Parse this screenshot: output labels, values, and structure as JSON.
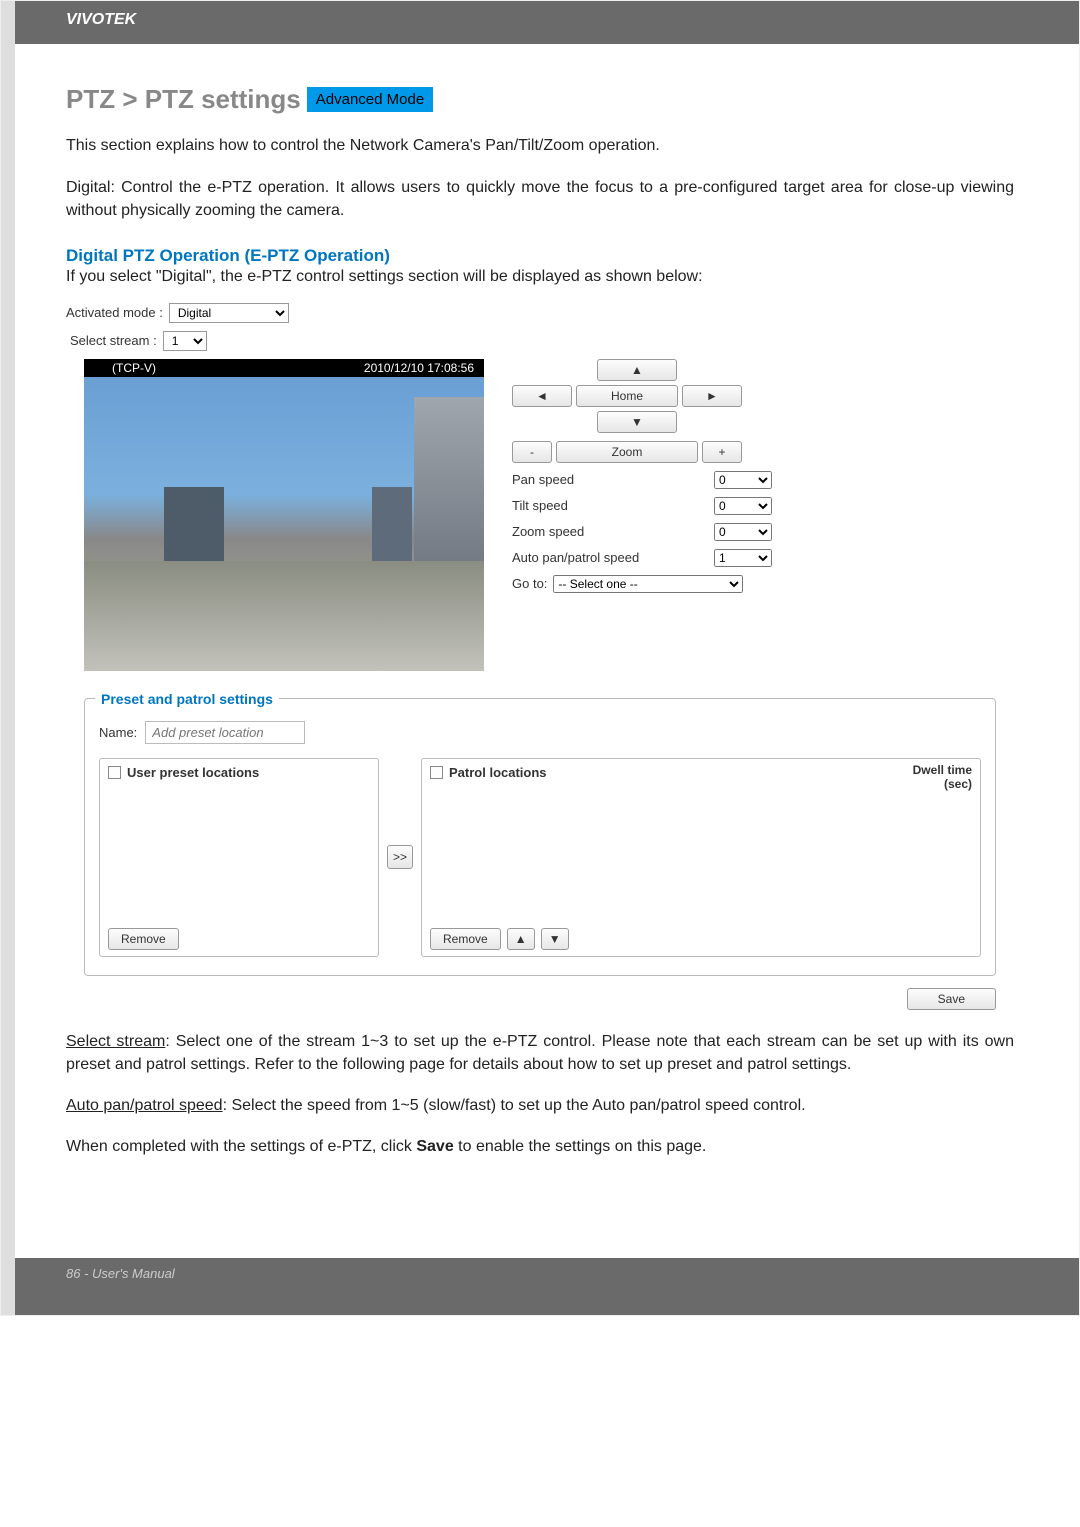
{
  "header": {
    "brand": "VIVOTEK"
  },
  "footer": {
    "text": "86 - User's Manual"
  },
  "title": {
    "breadcrumb": "PTZ > PTZ settings",
    "badge": "Advanced Mode"
  },
  "intro": {
    "p1": "This section explains how to control the Network Camera's Pan/Tilt/Zoom operation.",
    "p2": "Digital: Control the e-PTZ operation. It allows users to quickly move the focus to a pre-configured target area for close-up viewing without physically zooming the camera."
  },
  "section": {
    "heading": "Digital PTZ Operation (E-PTZ Operation)",
    "text": "If you select \"Digital\", the e-PTZ control settings section will be displayed as shown below:"
  },
  "ui": {
    "activated_mode_label": "Activated mode :",
    "activated_mode_value": "Digital",
    "select_stream_label": "Select stream :",
    "select_stream_value": "1",
    "video_header_left": "(TCP-V)",
    "video_header_right": "2010/12/10  17:08:56",
    "buttons": {
      "up": "▲",
      "down": "▼",
      "left": "◄",
      "right": "►",
      "home": "Home",
      "zoom_label": "Zoom",
      "minus": "-",
      "plus": "+"
    },
    "speeds": [
      {
        "label": "Pan speed",
        "value": "0"
      },
      {
        "label": "Tilt speed",
        "value": "0"
      },
      {
        "label": "Zoom speed",
        "value": "0"
      },
      {
        "label": "Auto pan/patrol speed",
        "value": "1"
      }
    ],
    "goto_label": "Go to:",
    "goto_value": "-- Select one --"
  },
  "preset": {
    "legend": "Preset and patrol settings",
    "name_label": "Name:",
    "name_placeholder": "Add preset location",
    "user_preset_title": "User preset locations",
    "patrol_title": "Patrol locations",
    "dwell_label_1": "Dwell time",
    "dwell_label_2": "(sec)",
    "move_btn": ">>",
    "remove": "Remove",
    "up": "▲",
    "down": "▼",
    "save": "Save"
  },
  "notes": {
    "select_stream_u": "Select stream",
    "select_stream_text": ": Select one of the stream 1~3 to set up the e-PTZ control. Please note that each stream can be set up with its own preset and patrol settings. Refer to the following page for details about how to set up preset and patrol settings.",
    "auto_u": "Auto pan/patrol speed",
    "auto_text": ": Select the speed from 1~5 (slow/fast) to set up the Auto pan/patrol speed control.",
    "save_text_1": "When completed with the settings of e-PTZ, click ",
    "save_bold": "Save",
    "save_text_2": " to enable the settings on this page."
  }
}
